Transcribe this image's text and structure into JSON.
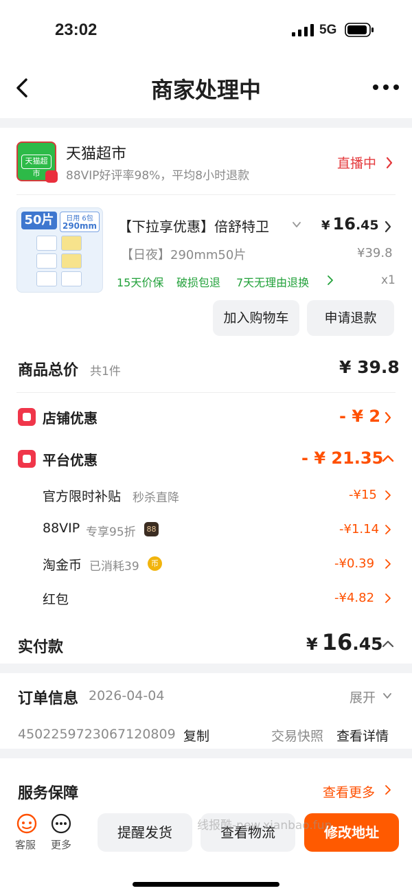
{
  "status": {
    "time": "23:02",
    "network": "5G"
  },
  "nav": {
    "title": "商家处理中"
  },
  "shop": {
    "name": "天猫超市",
    "logo_text": "天猫超市",
    "rating": "88VIP好评率98%，平均8小时退款",
    "live": "直播中"
  },
  "product": {
    "img_count": "50片",
    "img_tag1": "日用 6包",
    "img_tag2": "290mm",
    "title": "【下拉享优惠】倍舒特卫",
    "price_symbol": "¥",
    "price_int": "16",
    "price_dec": ".45",
    "spec": "【日夜】290mm50片",
    "orig_price": "¥39.8",
    "services": [
      "15天价保",
      "破损包退",
      "7天无理由退换"
    ],
    "qty": "x1",
    "btn_cart": "加入购物车",
    "btn_refund": "申请退款"
  },
  "summary": {
    "total_label": "商品总价",
    "total_count": "共1件",
    "total_value": "¥ 39.8",
    "shop_discount_label": "店铺优惠",
    "shop_discount_value": "- ¥ 2",
    "platform_discount_label": "平台优惠",
    "platform_discount_value": "- ¥ 21.35",
    "sub_items": [
      {
        "label": "官方限时补贴",
        "note": "秒杀直降",
        "value": "-¥15"
      },
      {
        "label": "88VIP",
        "note": "专享95折",
        "value": "-¥1.14"
      },
      {
        "label": "淘金币",
        "note": "已消耗39",
        "value": "-¥0.39"
      },
      {
        "label": "红包",
        "note": "",
        "value": "-¥4.82"
      }
    ],
    "badge_88": "88",
    "coin_glyph": "币",
    "paid_label": "实付款",
    "paid_symbol": "¥",
    "paid_int": "16",
    "paid_dec": ".45"
  },
  "order": {
    "label": "订单信息",
    "date": "2026-04-04",
    "expand": "展开",
    "number": "4502259723067120809",
    "copy": "复制",
    "snapshot": "交易快照",
    "details": "查看详情"
  },
  "service": {
    "label": "服务保障",
    "more": "查看更多"
  },
  "bottom": {
    "cs": "客服",
    "more": "更多",
    "remind": "提醒发货",
    "logistics": "查看物流",
    "change_address": "修改地址",
    "watermark": "线报酷-new.xianbao.fun"
  },
  "colors": {
    "accent_orange": "#ff5000",
    "live_red": "#e4393c",
    "green": "#22a13a"
  }
}
